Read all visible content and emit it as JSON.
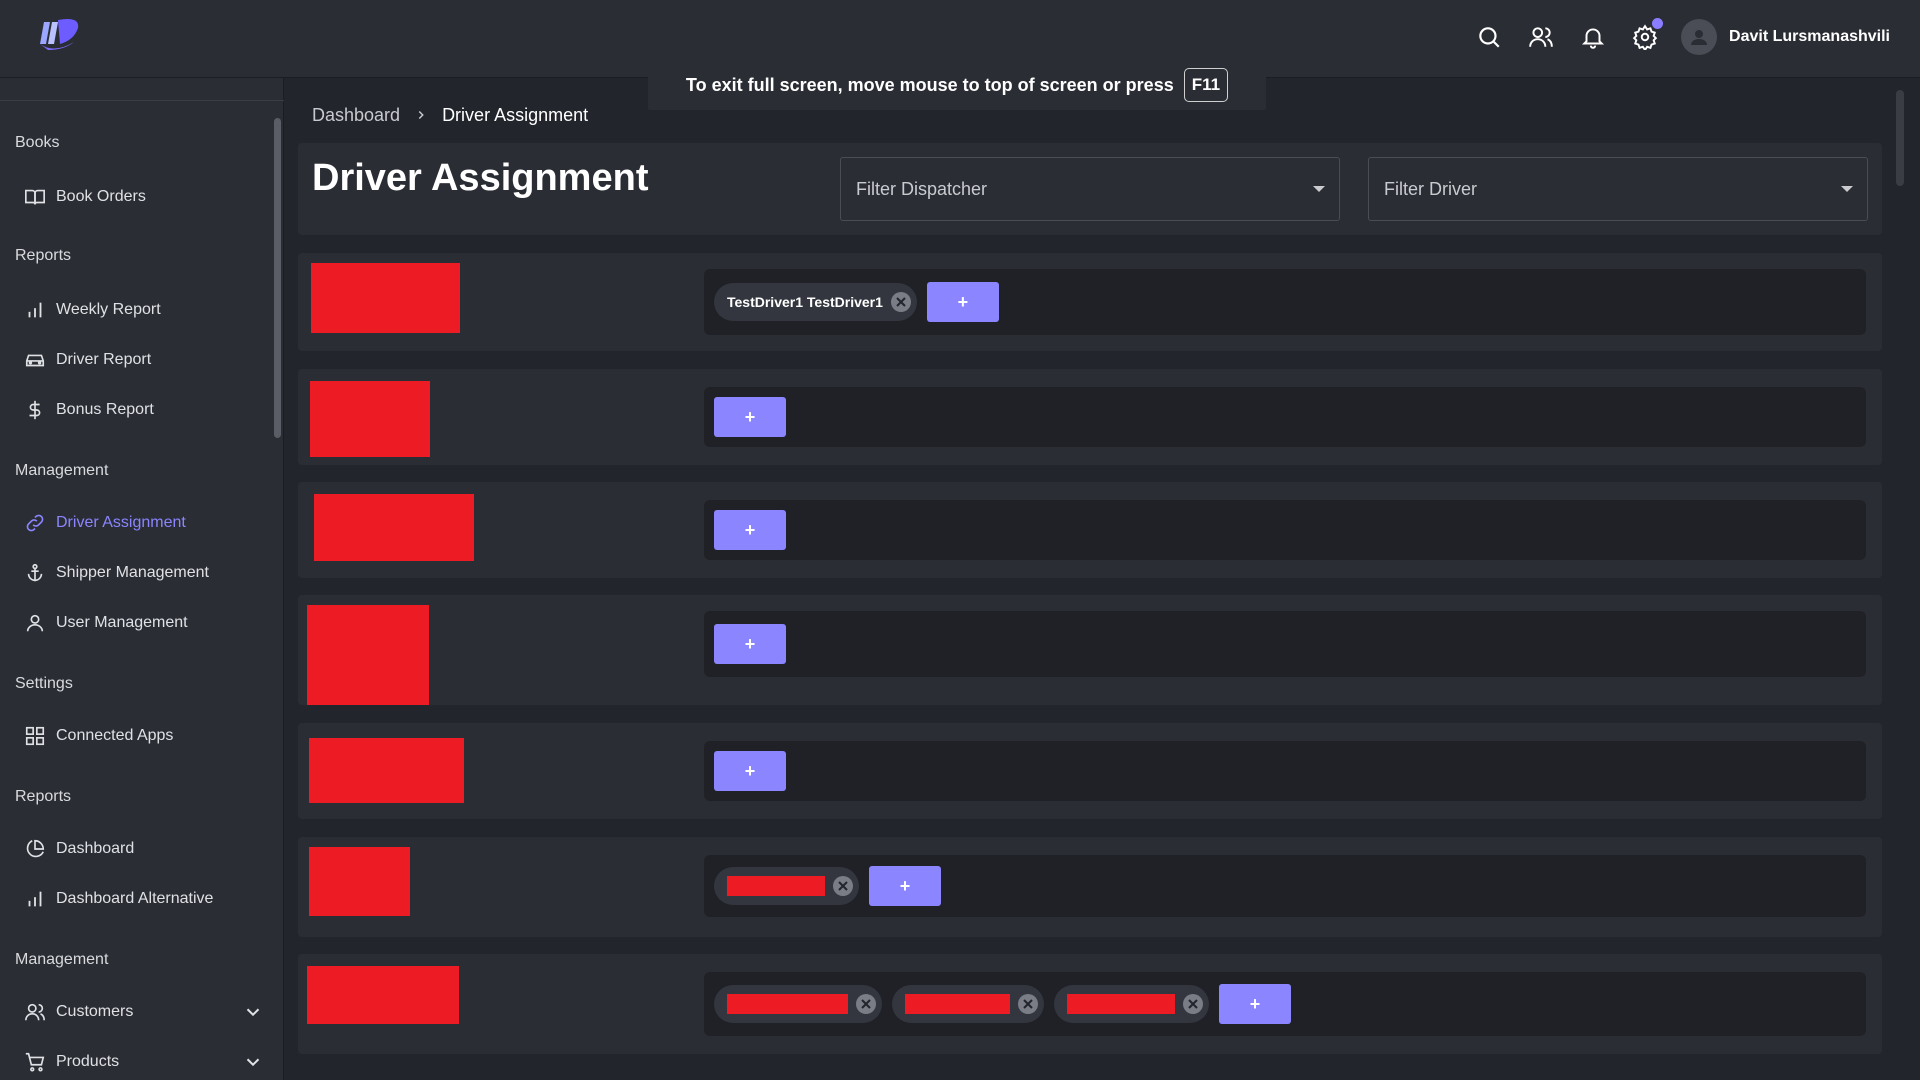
{
  "topbar": {
    "user_name": "Davit Lursmanashvili",
    "icons": [
      "search-icon",
      "users-icon",
      "bell-icon",
      "gear-icon",
      "avatar-icon"
    ],
    "accent": "#8b7dff"
  },
  "fullscreen_toast": {
    "text": "To exit full screen, move mouse to top of screen or press",
    "key": "F11"
  },
  "sidebar": {
    "sections": [
      {
        "title": "Books",
        "items": [
          {
            "label": "Book Orders",
            "icon": "book-open-icon"
          }
        ]
      },
      {
        "title": "Reports",
        "items": [
          {
            "label": "Weekly Report",
            "icon": "bar-chart-icon"
          },
          {
            "label": "Driver Report",
            "icon": "car-icon"
          },
          {
            "label": "Bonus Report",
            "icon": "dollar-icon"
          }
        ]
      },
      {
        "title": "Management",
        "items": [
          {
            "label": "Driver Assignment",
            "icon": "link-icon",
            "active": true
          },
          {
            "label": "Shipper Management",
            "icon": "anchor-icon"
          },
          {
            "label": "User Management",
            "icon": "user-icon"
          }
        ]
      },
      {
        "title": "Settings",
        "items": [
          {
            "label": "Connected Apps",
            "icon": "grid-icon"
          }
        ]
      },
      {
        "title": "Reports",
        "items": [
          {
            "label": "Dashboard",
            "icon": "pie-chart-icon"
          },
          {
            "label": "Dashboard Alternative",
            "icon": "bar-chart-icon"
          }
        ]
      },
      {
        "title": "Management",
        "items": [
          {
            "label": "Customers",
            "icon": "users-icon"
          },
          {
            "label": "Products",
            "icon": "cart-icon"
          }
        ]
      }
    ]
  },
  "breadcrumb": {
    "home": "Dashboard",
    "current": "Driver Assignment"
  },
  "header": {
    "title": "Driver Assignment",
    "filter_dispatcher": "Filter Dispatcher",
    "filter_driver": "Filter Driver"
  },
  "rows": [
    {
      "chips": [
        "TestDriver1 TestDriver1"
      ],
      "add_label": "+"
    },
    {
      "chips": [],
      "add_label": "+"
    },
    {
      "chips": [],
      "add_label": "+"
    },
    {
      "chips": [],
      "add_label": "+"
    },
    {
      "chips": [],
      "add_label": "+"
    },
    {
      "chips": [
        "redacted"
      ],
      "add_label": "+"
    },
    {
      "chips": [
        "redacted",
        "redacted",
        "redacted"
      ],
      "add_label": "+"
    }
  ],
  "colors": {
    "background": "#22252c",
    "card": "#2a2d34",
    "accent": "#8b85ff",
    "redaction": "#ed1c24"
  }
}
